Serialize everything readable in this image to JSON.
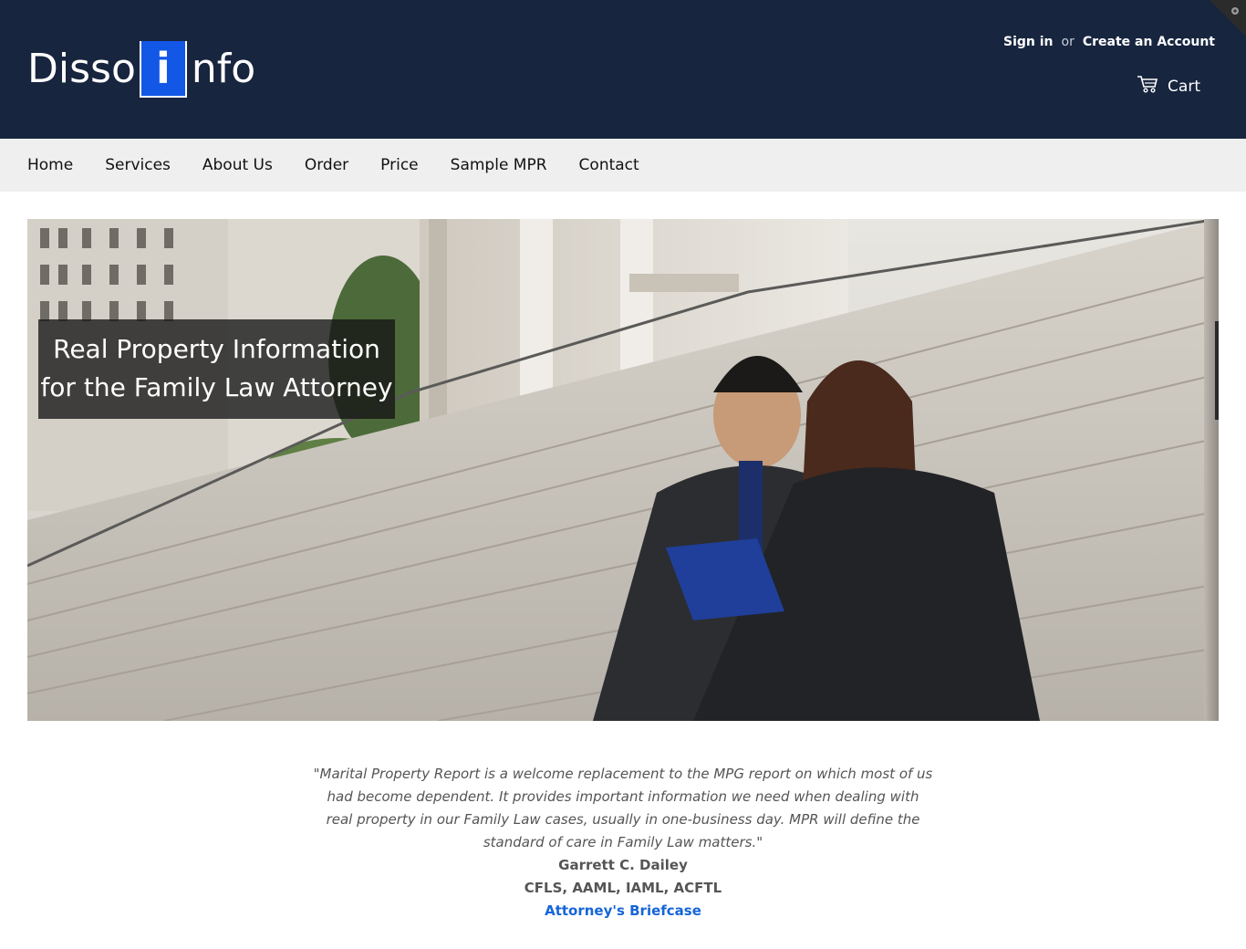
{
  "header": {
    "logo": {
      "part1": "Disso",
      "box_letter": "i",
      "part2": "nfo"
    },
    "sign_in": "Sign in",
    "or": "or",
    "create_account": "Create an Account",
    "cart": "Cart"
  },
  "nav": {
    "items": [
      "Home",
      "Services",
      "About Us",
      "Order",
      "Price",
      "Sample MPR",
      "Contact"
    ]
  },
  "hero": {
    "caption_line1": "Real Property Information",
    "caption_line2": "for the Family Law Attorney"
  },
  "testimonial": {
    "quote": "\"Marital Property Report is a welcome replacement to the MPG report on which most of us had become dependent. It provides important information we need when dealing with real property in our Family Law cases, usually in one-business day. MPR will define the standard of care in Family Law matters.\"",
    "author": "Garrett C. Dailey",
    "credentials": "CFLS, AAML, IAML, ACFTL",
    "source_link": "Attorney's Briefcase"
  },
  "colors": {
    "header_bg": "#17253f",
    "nav_bg": "#efefef",
    "logo_box": "#1257e6",
    "link_blue": "#1565d8"
  }
}
